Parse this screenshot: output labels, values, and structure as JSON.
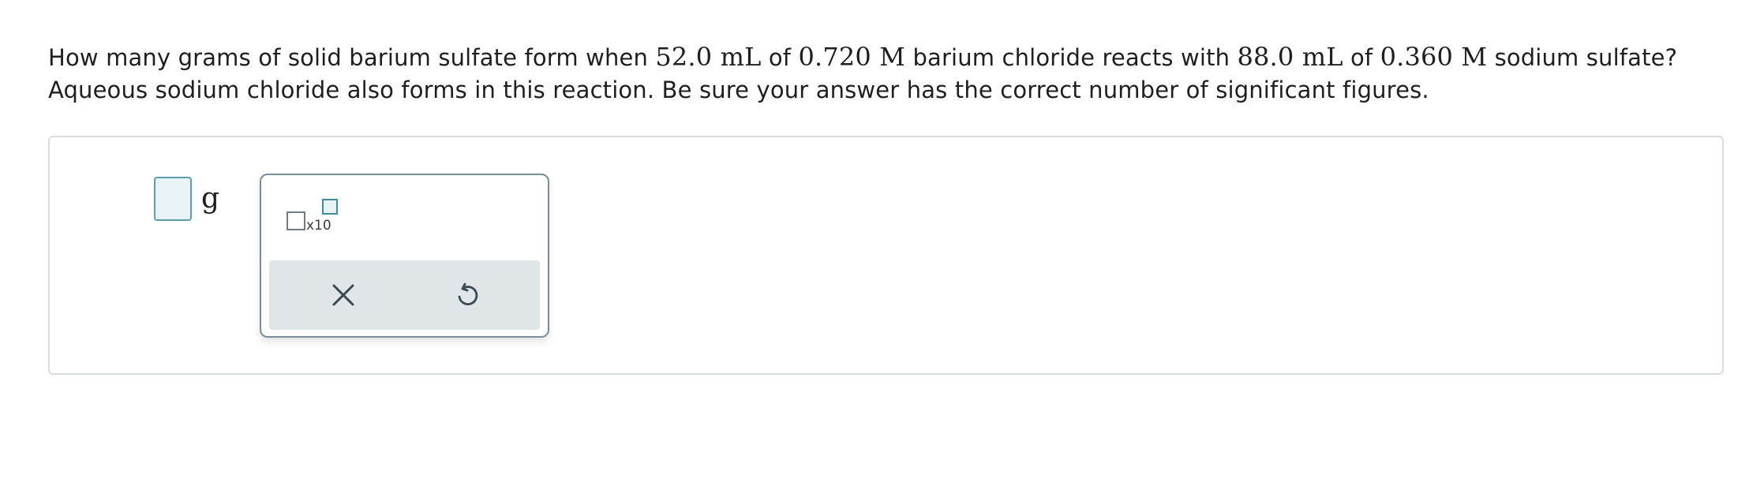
{
  "question": {
    "t1": "How many grams of solid barium sulfate form when ",
    "m1": "52.0 mL",
    "t2": " of ",
    "m2": "0.720 M",
    "t3": " barium chloride reacts with ",
    "m3": "88.0 mL",
    "t4": " of ",
    "m4": "0.360 M",
    "t5": " sodium sulfate? Aqueous sodium chloride also forms in this reaction. Be sure your answer has the correct number of significant figures."
  },
  "answer": {
    "value": "",
    "unit": "g"
  },
  "palette": {
    "sci_notation_label": "x10"
  },
  "icons": {
    "clear": "close-icon",
    "undo": "undo-icon"
  },
  "colors": {
    "input_fill": "#e7f3f5",
    "input_border": "#5c9eb0",
    "action_bar": "#e0e5e8"
  }
}
